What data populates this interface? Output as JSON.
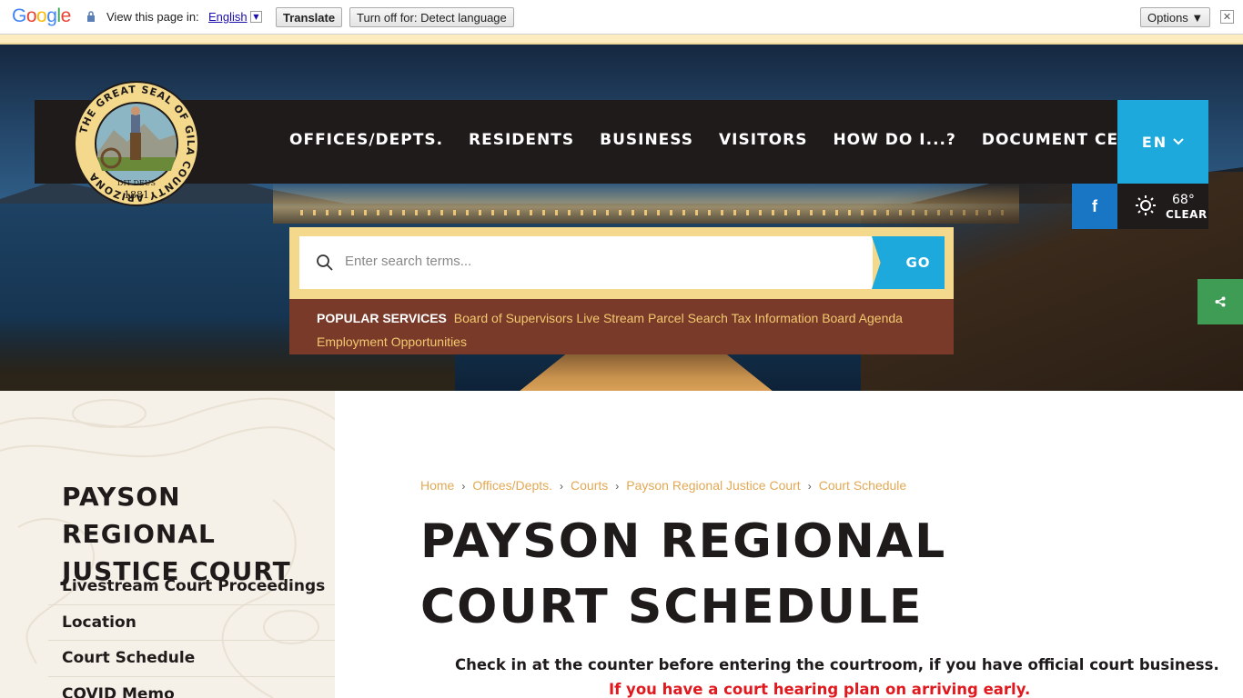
{
  "translate_bar": {
    "logo": [
      "G",
      "o",
      "o",
      "g",
      "l",
      "e"
    ],
    "view_in_label": "View this page in:",
    "language": "English",
    "translate_button": "Translate",
    "turn_off_button": "Turn off for: Detect language",
    "options_button": "Options ▼",
    "close": "✕"
  },
  "header": {
    "nav": [
      "OFFICES/DEPTS.",
      "RESIDENTS",
      "BUSINESS",
      "VISITORS",
      "HOW DO I...?",
      "DOCUMENT CENTER"
    ],
    "language_button": "EN",
    "facebook": "f",
    "weather": {
      "temp": "68°",
      "condition": "CLEAR"
    },
    "seal": {
      "ring_text": "THE GREAT SEAL OF GILA COUNTY ARIZONA",
      "motto": "DIT DEUS",
      "year": "1881"
    }
  },
  "search": {
    "placeholder": "Enter search terms...",
    "go_label": "GO",
    "popular_title": "POPULAR SERVICES",
    "popular_links": [
      "Board of Supervisors Live Stream",
      "Parcel Search",
      "Tax Information",
      "Board Agenda",
      "Employment Opportunities"
    ]
  },
  "sidebar": {
    "title": "PAYSON REGIONAL JUSTICE COURT",
    "items": [
      "Livestream Court Proceedings",
      "Location",
      "Court Schedule",
      "COVID Memo"
    ]
  },
  "breadcrumb": [
    "Home",
    "Offices/Depts.",
    "Courts",
    "Payson Regional Justice Court",
    "Court Schedule"
  ],
  "page": {
    "title": "PAYSON REGIONAL COURT SCHEDULE",
    "intro": "Check in at the counter before entering the courtroom, if you have official court business.",
    "intro_red": "If you have a court hearing plan on arriving early."
  },
  "colors": {
    "accent_blue": "#1ea9dc",
    "dark": "#1f1b1a",
    "gold": "#f4d88c",
    "brown": "#7a3a2a",
    "link_orange": "#e2a955",
    "alert_red": "#e0191f",
    "share_green": "#3e9c55",
    "facebook_blue": "#1976c4"
  }
}
